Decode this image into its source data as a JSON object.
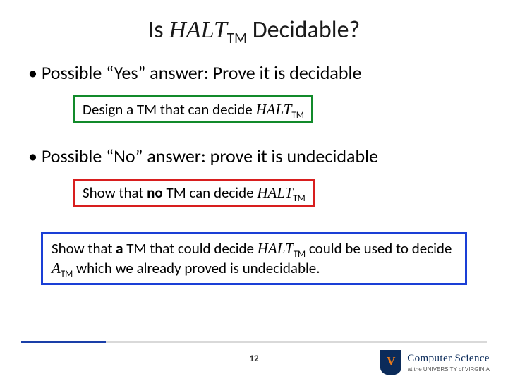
{
  "title": {
    "pre": "Is ",
    "term": "HALT",
    "sub": "TM",
    "post": " Decidable?"
  },
  "bullet1": "Possible “Yes” answer: Prove it is decidable",
  "box1": {
    "pre": "Design a TM that can decide ",
    "term": "HALT",
    "sub": "TM"
  },
  "bullet2": "Possible “No” answer: prove it is undecidable",
  "box2": {
    "pre": "Show that ",
    "bold": "no",
    "mid": " TM can decide ",
    "term": "HALT",
    "sub": "TM"
  },
  "box3": {
    "p1": "Show that ",
    "b1": "a",
    "p2": " TM that could decide ",
    "term1": "HALT",
    "sub1": "TM",
    "p3": " could be used to decide ",
    "term2": "A",
    "sub2": "TM",
    "p4": " which we already proved is undecidable."
  },
  "page": "12",
  "logo": {
    "main": "Computer Science",
    "sub": "at the UNIVERSITY of VIRGINIA"
  }
}
